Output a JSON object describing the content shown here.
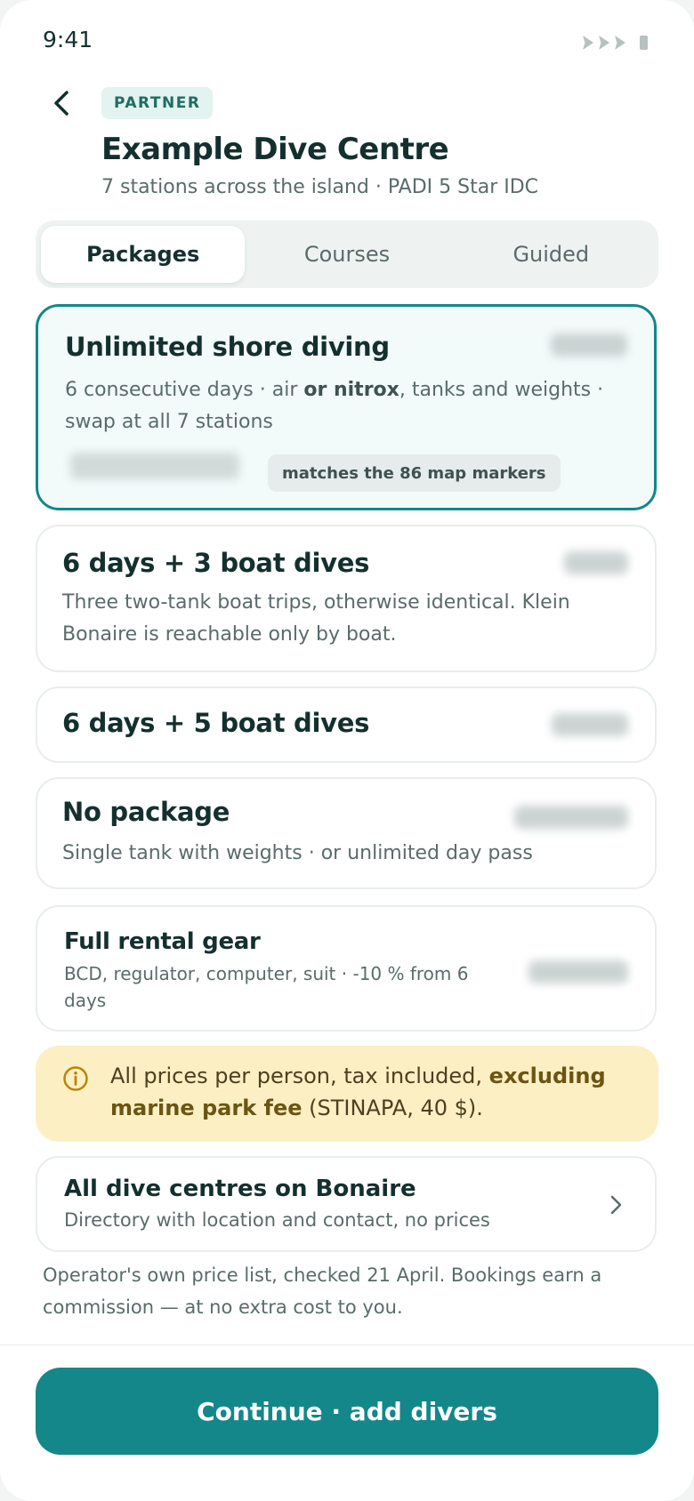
{
  "status_bar": {
    "time": "9:41"
  },
  "header": {
    "badge": "PARTNER",
    "title": "Example Dive Centre",
    "subtitle": "7 stations across the island · PADI 5 Star IDC"
  },
  "tabs": [
    {
      "label": "Packages",
      "active": true
    },
    {
      "label": "Courses",
      "active": false
    },
    {
      "label": "Guided",
      "active": false
    }
  ],
  "packages": [
    {
      "title": "Unlimited shore diving",
      "desc_before": "6 consecutive days · air ",
      "desc_bold": "or nitrox",
      "desc_after": ", tanks and weights · swap at all 7 stations",
      "chip": "matches the 86 map markers",
      "selected": true
    },
    {
      "title": "6 days + 3 boat dives",
      "desc": "Three two-tank boat trips, otherwise identical. Klein Bonaire is reachable only by boat."
    },
    {
      "title": "6 days + 5 boat dives"
    },
    {
      "title": "No package",
      "desc": "Single tank with weights · or unlimited day pass"
    },
    {
      "title": "Full rental gear",
      "desc": "BCD, regulator, computer, suit · -10 % from 6 days"
    }
  ],
  "notice": {
    "text_before": "All prices per person, tax included, ",
    "text_bold": "excluding marine park fee",
    "text_after": " (STINAPA, 40 $)."
  },
  "directory_link": {
    "title": "All dive centres on Bonaire",
    "desc": "Directory with location and contact, no prices"
  },
  "footnote": "Operator's own price list, checked 21 April. Bookings earn a commission — at no extra cost to you.",
  "cta": {
    "label": "Continue · add divers"
  },
  "colors": {
    "accent": "#14878a",
    "notice_bg": "#fcefc4",
    "badge_bg": "#e3f3ef"
  }
}
